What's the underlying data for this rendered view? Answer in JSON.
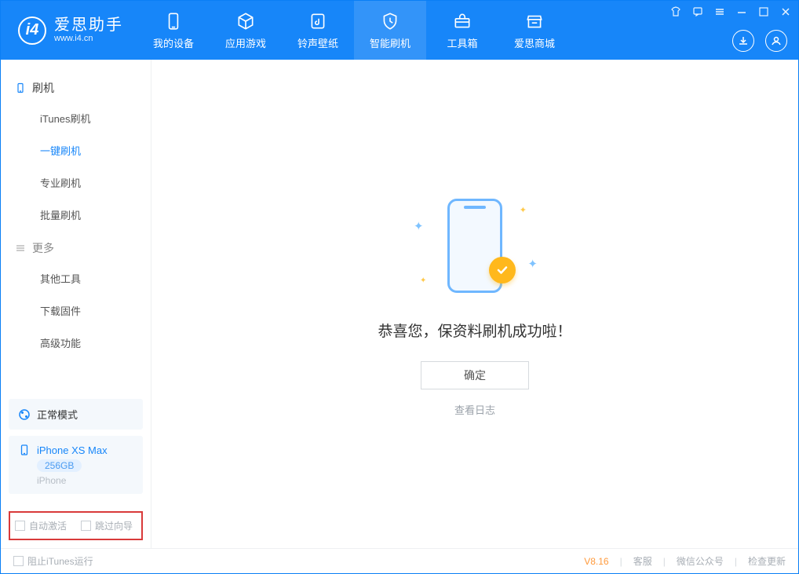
{
  "app": {
    "name_cn": "爱思助手",
    "name_en": "www.i4.cn"
  },
  "nav": [
    {
      "label": "我的设备",
      "icon": "device"
    },
    {
      "label": "应用游戏",
      "icon": "cube"
    },
    {
      "label": "铃声壁纸",
      "icon": "music"
    },
    {
      "label": "智能刷机",
      "icon": "shield",
      "active": true
    },
    {
      "label": "工具箱",
      "icon": "toolbox"
    },
    {
      "label": "爱思商城",
      "icon": "store"
    }
  ],
  "sidebar": {
    "group1": {
      "title": "刷机",
      "items": [
        "iTunes刷机",
        "一键刷机",
        "专业刷机",
        "批量刷机"
      ],
      "active_index": 1
    },
    "group2": {
      "title": "更多",
      "items": [
        "其他工具",
        "下载固件",
        "高级功能"
      ]
    }
  },
  "mode": {
    "label": "正常模式"
  },
  "device": {
    "name": "iPhone XS Max",
    "storage": "256GB",
    "type": "iPhone"
  },
  "options": {
    "auto_activate": "自动激活",
    "skip_wizard": "跳过向导"
  },
  "main": {
    "message": "恭喜您，保资料刷机成功啦！",
    "ok": "确定",
    "view_log": "查看日志"
  },
  "footer": {
    "block_itunes": "阻止iTunes运行",
    "version": "V8.16",
    "support": "客服",
    "wechat": "微信公众号",
    "update": "检查更新"
  }
}
